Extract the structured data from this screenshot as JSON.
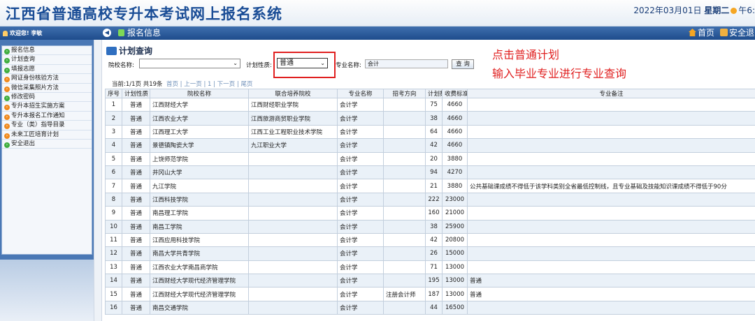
{
  "header": {
    "system_title": "江西省普通高校专升本考试网上报名系统",
    "date": "2022年03月01日",
    "weekday": "星期二",
    "time": "午6:"
  },
  "topbar": {
    "welcome": "欢迎您! 李敏",
    "breadcrumb": "报名信息",
    "home": "首页",
    "logout": "安全退出"
  },
  "sidebar": {
    "items": [
      {
        "label": "报名信息",
        "color": "green"
      },
      {
        "label": "计划查询",
        "color": "green"
      },
      {
        "label": "填报志愿",
        "color": "green"
      },
      {
        "label": "网证身份核验方法",
        "color": "orange"
      },
      {
        "label": "微信采集照片方法",
        "color": "orange"
      },
      {
        "label": "修改密码",
        "color": "green"
      },
      {
        "label": "专升本招生实施方案",
        "color": "orange"
      },
      {
        "label": "专升本报名工作通知",
        "color": "orange"
      },
      {
        "label": "专业（类）指导目录",
        "color": "orange"
      },
      {
        "label": "未来工匠培育计划",
        "color": "orange"
      },
      {
        "label": "安全退出",
        "color": "green"
      }
    ]
  },
  "query": {
    "title": "计划查询",
    "school_label": "院校名称:",
    "school_value": "",
    "type_label": "计划性质:",
    "type_value": "普通",
    "major_label": "专业名称:",
    "major_value": "会计",
    "search_button": "查 询"
  },
  "annotations": {
    "line1": "点击普通计划",
    "line2": "输入毕业专业进行专业查询"
  },
  "pager": {
    "info": "当前:1/1页 共19条",
    "links": "首页 | 上一页 | 1 | 下一页 | 尾页"
  },
  "table": {
    "headers": [
      "序号",
      "计划性质",
      "院校名称",
      "联合培养院校",
      "专业名称",
      "招考方向",
      "计划数",
      "收费标准",
      "专业备注"
    ],
    "rows": [
      [
        "1",
        "普通",
        "江西财经大学",
        "江西财经职业学院",
        "会计学",
        "",
        "75",
        "4660",
        ""
      ],
      [
        "2",
        "普通",
        "江西农业大学",
        "江西旅游商贸职业学院",
        "会计学",
        "",
        "38",
        "4660",
        ""
      ],
      [
        "3",
        "普通",
        "江西理工大学",
        "江西工业工程职业技术学院",
        "会计学",
        "",
        "64",
        "4660",
        ""
      ],
      [
        "4",
        "普通",
        "景德镇陶瓷大学",
        "九江职业大学",
        "会计学",
        "",
        "42",
        "4660",
        ""
      ],
      [
        "5",
        "普通",
        "上饶师范学院",
        "",
        "会计学",
        "",
        "20",
        "3880",
        ""
      ],
      [
        "6",
        "普通",
        "井冈山大学",
        "",
        "会计学",
        "",
        "94",
        "4270",
        ""
      ],
      [
        "7",
        "普通",
        "九江学院",
        "",
        "会计学",
        "",
        "21",
        "3880",
        "公共基础课成绩不得低于该学科类别全省最低控制线，且专业基础及技能知识课成绩不得低于90分"
      ],
      [
        "8",
        "普通",
        "江西科技学院",
        "",
        "会计学",
        "",
        "222",
        "23000",
        ""
      ],
      [
        "9",
        "普通",
        "南昌理工学院",
        "",
        "会计学",
        "",
        "160",
        "21000",
        ""
      ],
      [
        "10",
        "普通",
        "南昌工学院",
        "",
        "会计学",
        "",
        "38",
        "25900",
        ""
      ],
      [
        "11",
        "普通",
        "江西应用科技学院",
        "",
        "会计学",
        "",
        "42",
        "20800",
        ""
      ],
      [
        "12",
        "普通",
        "南昌大学共青学院",
        "",
        "会计学",
        "",
        "26",
        "15000",
        ""
      ],
      [
        "13",
        "普通",
        "江西农业大学南昌商学院",
        "",
        "会计学",
        "",
        "71",
        "13000",
        ""
      ],
      [
        "14",
        "普通",
        "江西财经大学现代经济管理学院",
        "",
        "会计学",
        "",
        "195",
        "13000",
        "普通"
      ],
      [
        "15",
        "普通",
        "江西财经大学现代经济管理学院",
        "",
        "会计学",
        "注册会计师",
        "187",
        "13000",
        "普通"
      ],
      [
        "16",
        "普通",
        "南昌交通学院",
        "",
        "会计学",
        "",
        "44",
        "16500",
        ""
      ]
    ]
  }
}
